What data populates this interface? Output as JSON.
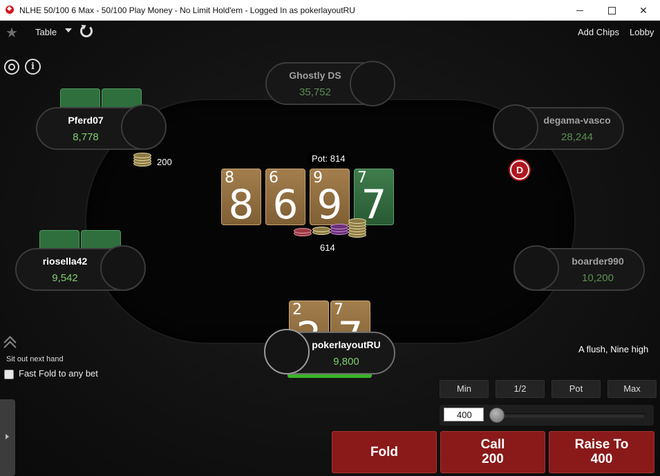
{
  "window": {
    "title": "NLHE 50/100 6 Max - 50/100 Play Money - No Limit Hold'em - Logged In as pokerlayoutRU"
  },
  "toolbar": {
    "table_menu": "Table",
    "add_chips": "Add Chips",
    "lobby": "Lobby"
  },
  "players": {
    "ghostly": {
      "name": "Ghostly DS",
      "stack": "35,752"
    },
    "pferd": {
      "name": "Pferd07",
      "stack": "8,778"
    },
    "degama": {
      "name": "degama-vasco",
      "stack": "28,244"
    },
    "riosella": {
      "name": "riosella42",
      "stack": "9,542"
    },
    "boarder": {
      "name": "boarder990",
      "stack": "10,200"
    },
    "hero": {
      "name": "pokerlayoutRU",
      "stack": "9,800"
    }
  },
  "bets": {
    "pferd": "200",
    "center": "614"
  },
  "pot": "Pot: 814",
  "board": [
    {
      "rank": "8",
      "color": "brown"
    },
    {
      "rank": "6",
      "color": "brown"
    },
    {
      "rank": "9",
      "color": "brown"
    },
    {
      "rank": "7",
      "color": "green"
    }
  ],
  "hero_cards": [
    {
      "rank": "2",
      "color": "brown"
    },
    {
      "rank": "7",
      "color": "brown"
    }
  ],
  "dealer_button": "D",
  "hand_description": "A flush, Nine high",
  "left_panel": {
    "sit_out": "Sit out next hand",
    "fast_fold": "Fast Fold to any bet",
    "fast_fold_checked": false
  },
  "bet_presets": {
    "min": "Min",
    "half": "1/2",
    "pot": "Pot",
    "max": "Max"
  },
  "bet_amount": "400",
  "actions": {
    "fold": "Fold",
    "call_label": "Call",
    "call_amount": "200",
    "raise_label": "Raise To",
    "raise_amount": "400"
  },
  "colors": {
    "action_red": "#8a1a1a",
    "stack_green": "#7fcf6e",
    "card_brown": "#8e6c3d",
    "card_green": "#336b40",
    "dealer_red": "#b0151f"
  }
}
